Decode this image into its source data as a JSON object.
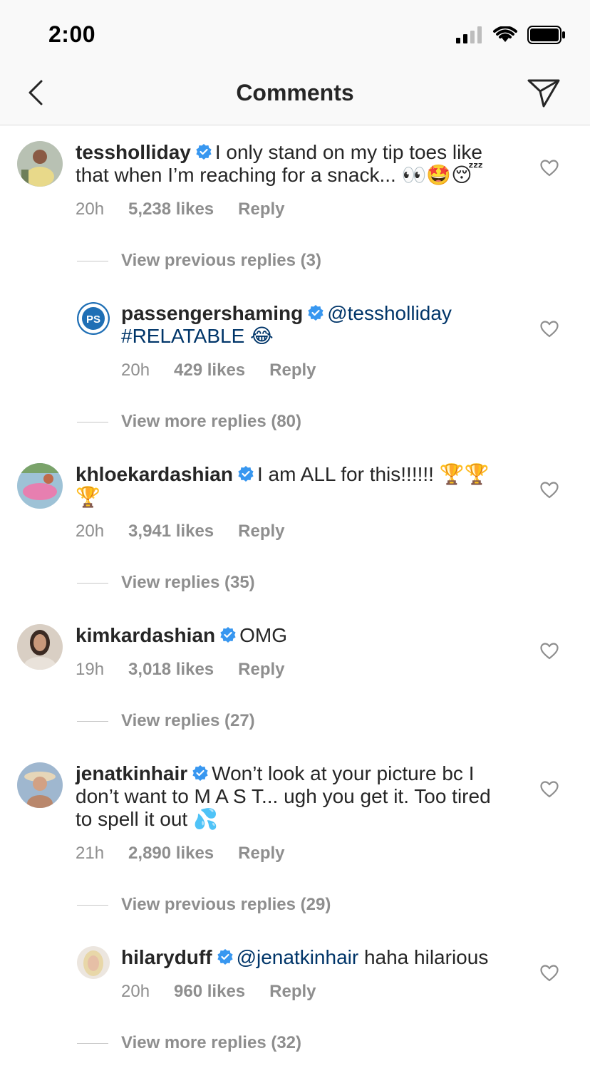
{
  "status": {
    "time": "2:00"
  },
  "nav": {
    "title": "Comments"
  },
  "comments": [
    {
      "username": "tessholliday",
      "text": "I only stand on my tip toes like that when I’m reaching for a snack... 👀🤩😴",
      "time": "20h",
      "likes": "5,238 likes",
      "reply": "Reply",
      "replies_link": "View previous replies (3)"
    },
    {
      "username": "passengershaming",
      "mention": "@tessholliday",
      "text": "#RELATABLE 😂",
      "time": "20h",
      "likes": "429 likes",
      "reply": "Reply",
      "replies_link": "View more replies (80)"
    },
    {
      "username": "khloekardashian",
      "text": "I am ALL for this!!!!!! 🏆🏆🏆",
      "time": "20h",
      "likes": "3,941 likes",
      "reply": "Reply",
      "replies_link": "View replies (35)"
    },
    {
      "username": "kimkardashian",
      "text": "OMG",
      "time": "19h",
      "likes": "3,018 likes",
      "reply": "Reply",
      "replies_link": "View replies (27)"
    },
    {
      "username": "jenatkinhair",
      "text": "Won’t look at your picture bc I don’t want to M A S T... ugh you get it. Too tired to spell it out 💦",
      "time": "21h",
      "likes": "2,890 likes",
      "reply": "Reply",
      "replies_link": "View previous replies (29)"
    },
    {
      "username": "hilaryduff",
      "mention": "@jenatkinhair",
      "text": "haha hilarious",
      "time": "20h",
      "likes": "960 likes",
      "reply": "Reply",
      "replies_link": "View more replies (32)"
    }
  ],
  "colors": {
    "verified": "#3897f0",
    "mention": "#003569",
    "meta": "#8e8e8e"
  },
  "icons": {
    "back": "chevron-left-icon",
    "send": "paper-plane-icon",
    "like": "heart-outline-icon",
    "verified": "verified-badge-icon"
  }
}
